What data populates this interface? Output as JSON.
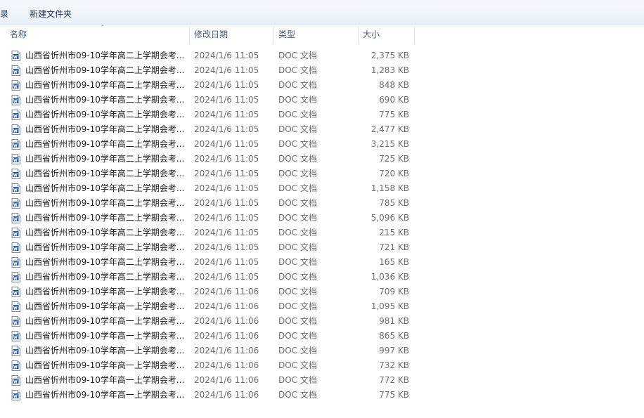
{
  "toolbar": {
    "partial_label": "录",
    "new_folder_label": "新建文件夹"
  },
  "columns": {
    "name": "名称",
    "date": "修改日期",
    "type": "类型",
    "size": "大小"
  },
  "files": [
    {
      "name": "山西省忻州市09-10学年高二上学期会考...",
      "date": "2024/1/6 11:05",
      "type": "DOC 文档",
      "size": "2,375 KB"
    },
    {
      "name": "山西省忻州市09-10学年高二上学期会考...",
      "date": "2024/1/6 11:05",
      "type": "DOC 文档",
      "size": "1,283 KB"
    },
    {
      "name": "山西省忻州市09-10学年高二上学期会考...",
      "date": "2024/1/6 11:05",
      "type": "DOC 文档",
      "size": "848 KB"
    },
    {
      "name": "山西省忻州市09-10学年高二上学期会考...",
      "date": "2024/1/6 11:05",
      "type": "DOC 文档",
      "size": "690 KB"
    },
    {
      "name": "山西省忻州市09-10学年高二上学期会考...",
      "date": "2024/1/6 11:05",
      "type": "DOC 文档",
      "size": "775 KB"
    },
    {
      "name": "山西省忻州市09-10学年高二上学期会考...",
      "date": "2024/1/6 11:05",
      "type": "DOC 文档",
      "size": "2,477 KB"
    },
    {
      "name": "山西省忻州市09-10学年高二上学期会考...",
      "date": "2024/1/6 11:05",
      "type": "DOC 文档",
      "size": "3,215 KB"
    },
    {
      "name": "山西省忻州市09-10学年高二上学期会考...",
      "date": "2024/1/6 11:05",
      "type": "DOC 文档",
      "size": "725 KB"
    },
    {
      "name": "山西省忻州市09-10学年高二上学期会考...",
      "date": "2024/1/6 11:05",
      "type": "DOC 文档",
      "size": "720 KB"
    },
    {
      "name": "山西省忻州市09-10学年高二上学期会考...",
      "date": "2024/1/6 11:05",
      "type": "DOC 文档",
      "size": "1,158 KB"
    },
    {
      "name": "山西省忻州市09-10学年高二上学期会考...",
      "date": "2024/1/6 11:05",
      "type": "DOC 文档",
      "size": "785 KB"
    },
    {
      "name": "山西省忻州市09-10学年高二上学期会考...",
      "date": "2024/1/6 11:05",
      "type": "DOC 文档",
      "size": "5,096 KB"
    },
    {
      "name": "山西省忻州市09-10学年高二上学期会考...",
      "date": "2024/1/6 11:05",
      "type": "DOC 文档",
      "size": "215 KB"
    },
    {
      "name": "山西省忻州市09-10学年高二上学期会考...",
      "date": "2024/1/6 11:05",
      "type": "DOC 文档",
      "size": "721 KB"
    },
    {
      "name": "山西省忻州市09-10学年高二上学期会考...",
      "date": "2024/1/6 11:05",
      "type": "DOC 文档",
      "size": "165 KB"
    },
    {
      "name": "山西省忻州市09-10学年高二上学期会考...",
      "date": "2024/1/6 11:05",
      "type": "DOC 文档",
      "size": "1,036 KB"
    },
    {
      "name": "山西省忻州市09-10学年高一上学期会考...",
      "date": "2024/1/6 11:06",
      "type": "DOC 文档",
      "size": "709 KB"
    },
    {
      "name": "山西省忻州市09-10学年高一上学期会考...",
      "date": "2024/1/6 11:06",
      "type": "DOC 文档",
      "size": "1,095 KB"
    },
    {
      "name": "山西省忻州市09-10学年高一上学期会考...",
      "date": "2024/1/6 11:06",
      "type": "DOC 文档",
      "size": "981 KB"
    },
    {
      "name": "山西省忻州市09-10学年高一上学期会考...",
      "date": "2024/1/6 11:06",
      "type": "DOC 文档",
      "size": "865 KB"
    },
    {
      "name": "山西省忻州市09-10学年高一上学期会考...",
      "date": "2024/1/6 11:06",
      "type": "DOC 文档",
      "size": "997 KB"
    },
    {
      "name": "山西省忻州市09-10学年高一上学期会考...",
      "date": "2024/1/6 11:06",
      "type": "DOC 文档",
      "size": "732 KB"
    },
    {
      "name": "山西省忻州市09-10学年高一上学期会考...",
      "date": "2024/1/6 11:06",
      "type": "DOC 文档",
      "size": "772 KB"
    },
    {
      "name": "山西省忻州市09-10学年高一上学期会考...",
      "date": "2024/1/6 11:06",
      "type": "DOC 文档",
      "size": "775 KB"
    }
  ],
  "icons": {
    "file": "word-doc-icon",
    "sort": "sort-up-arrow-icon"
  },
  "colors": {
    "toolbar_bg": "#eaf1fa",
    "icon_blue": "#2b5797"
  }
}
